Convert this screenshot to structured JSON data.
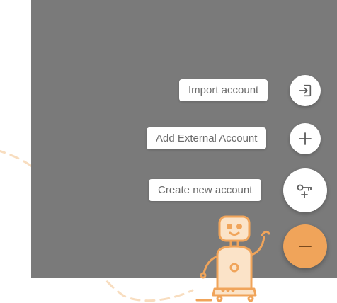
{
  "menu": {
    "items": [
      {
        "label": "Import account",
        "icon": "import-icon"
      },
      {
        "label": "Add External Account",
        "icon": "plus-icon"
      },
      {
        "label": "Create new account",
        "icon": "key-icon"
      }
    ],
    "toggle_icon": "minus-icon"
  },
  "colors": {
    "accent": "#f0a45a",
    "overlay": "#7a7a7a",
    "decoration": "#f8ddbf"
  },
  "illustration": "robot-mascot"
}
